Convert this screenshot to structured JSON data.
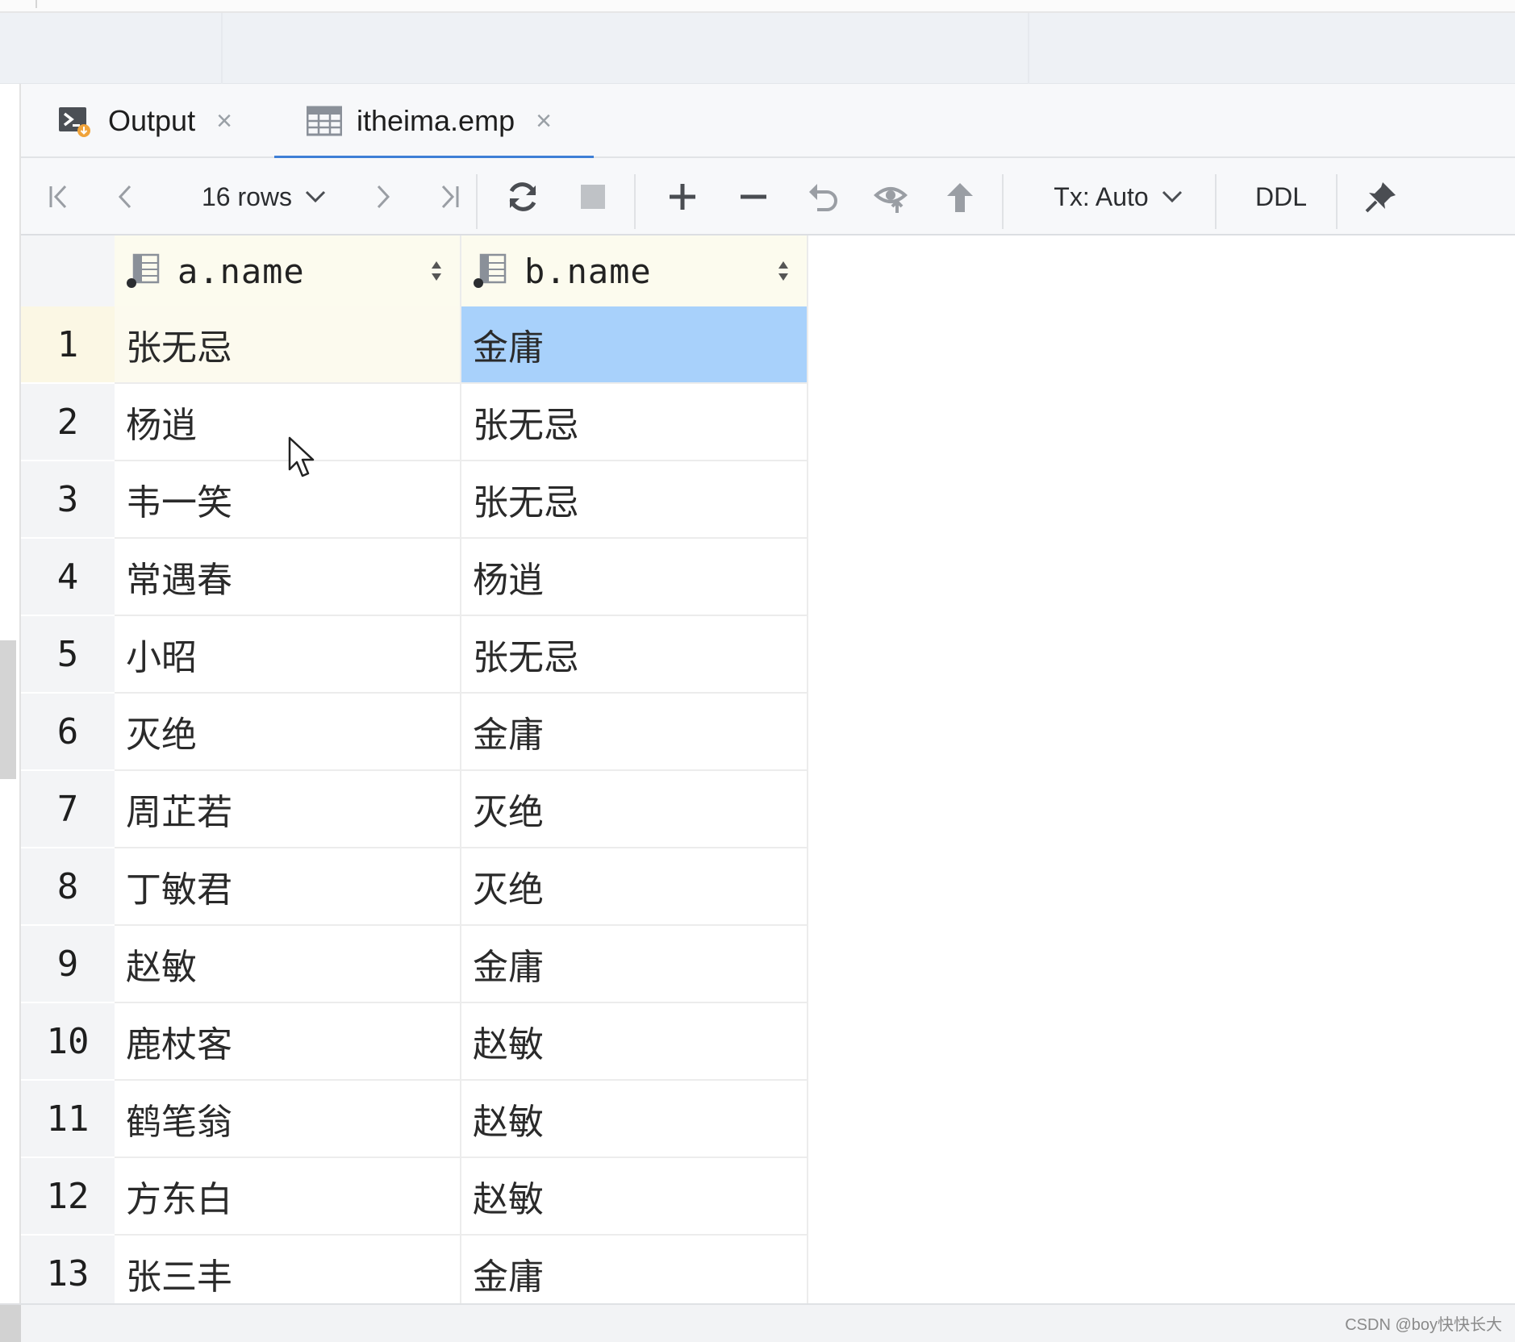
{
  "tabs": [
    {
      "label": "Output",
      "icon": "terminal-output-icon",
      "close": "×"
    },
    {
      "label": "itheima.emp",
      "icon": "table-icon",
      "close": "×",
      "active": true
    }
  ],
  "toolbar": {
    "row_count": "16 rows",
    "tx_mode": "Tx: Auto",
    "ddl": "DDL"
  },
  "grid": {
    "columns": [
      "a.name",
      "b.name"
    ],
    "rows": [
      {
        "num": "1",
        "a": "张无忌",
        "b": "金庸"
      },
      {
        "num": "2",
        "a": "杨逍",
        "b": "张无忌"
      },
      {
        "num": "3",
        "a": "韦一笑",
        "b": "张无忌"
      },
      {
        "num": "4",
        "a": "常遇春",
        "b": "杨逍"
      },
      {
        "num": "5",
        "a": "小昭",
        "b": "张无忌"
      },
      {
        "num": "6",
        "a": "灭绝",
        "b": "金庸"
      },
      {
        "num": "7",
        "a": "周芷若",
        "b": "灭绝"
      },
      {
        "num": "8",
        "a": "丁敏君",
        "b": "灭绝"
      },
      {
        "num": "9",
        "a": "赵敏",
        "b": "金庸"
      },
      {
        "num": "10",
        "a": "鹿杖客",
        "b": "赵敏"
      },
      {
        "num": "11",
        "a": "鹤笔翁",
        "b": "赵敏"
      },
      {
        "num": "12",
        "a": "方东白",
        "b": "赵敏"
      },
      {
        "num": "13",
        "a": "张三丰",
        "b": "金庸"
      }
    ],
    "selected_color": "#a8d1fb"
  },
  "watermark": "CSDN @boy快快长大"
}
